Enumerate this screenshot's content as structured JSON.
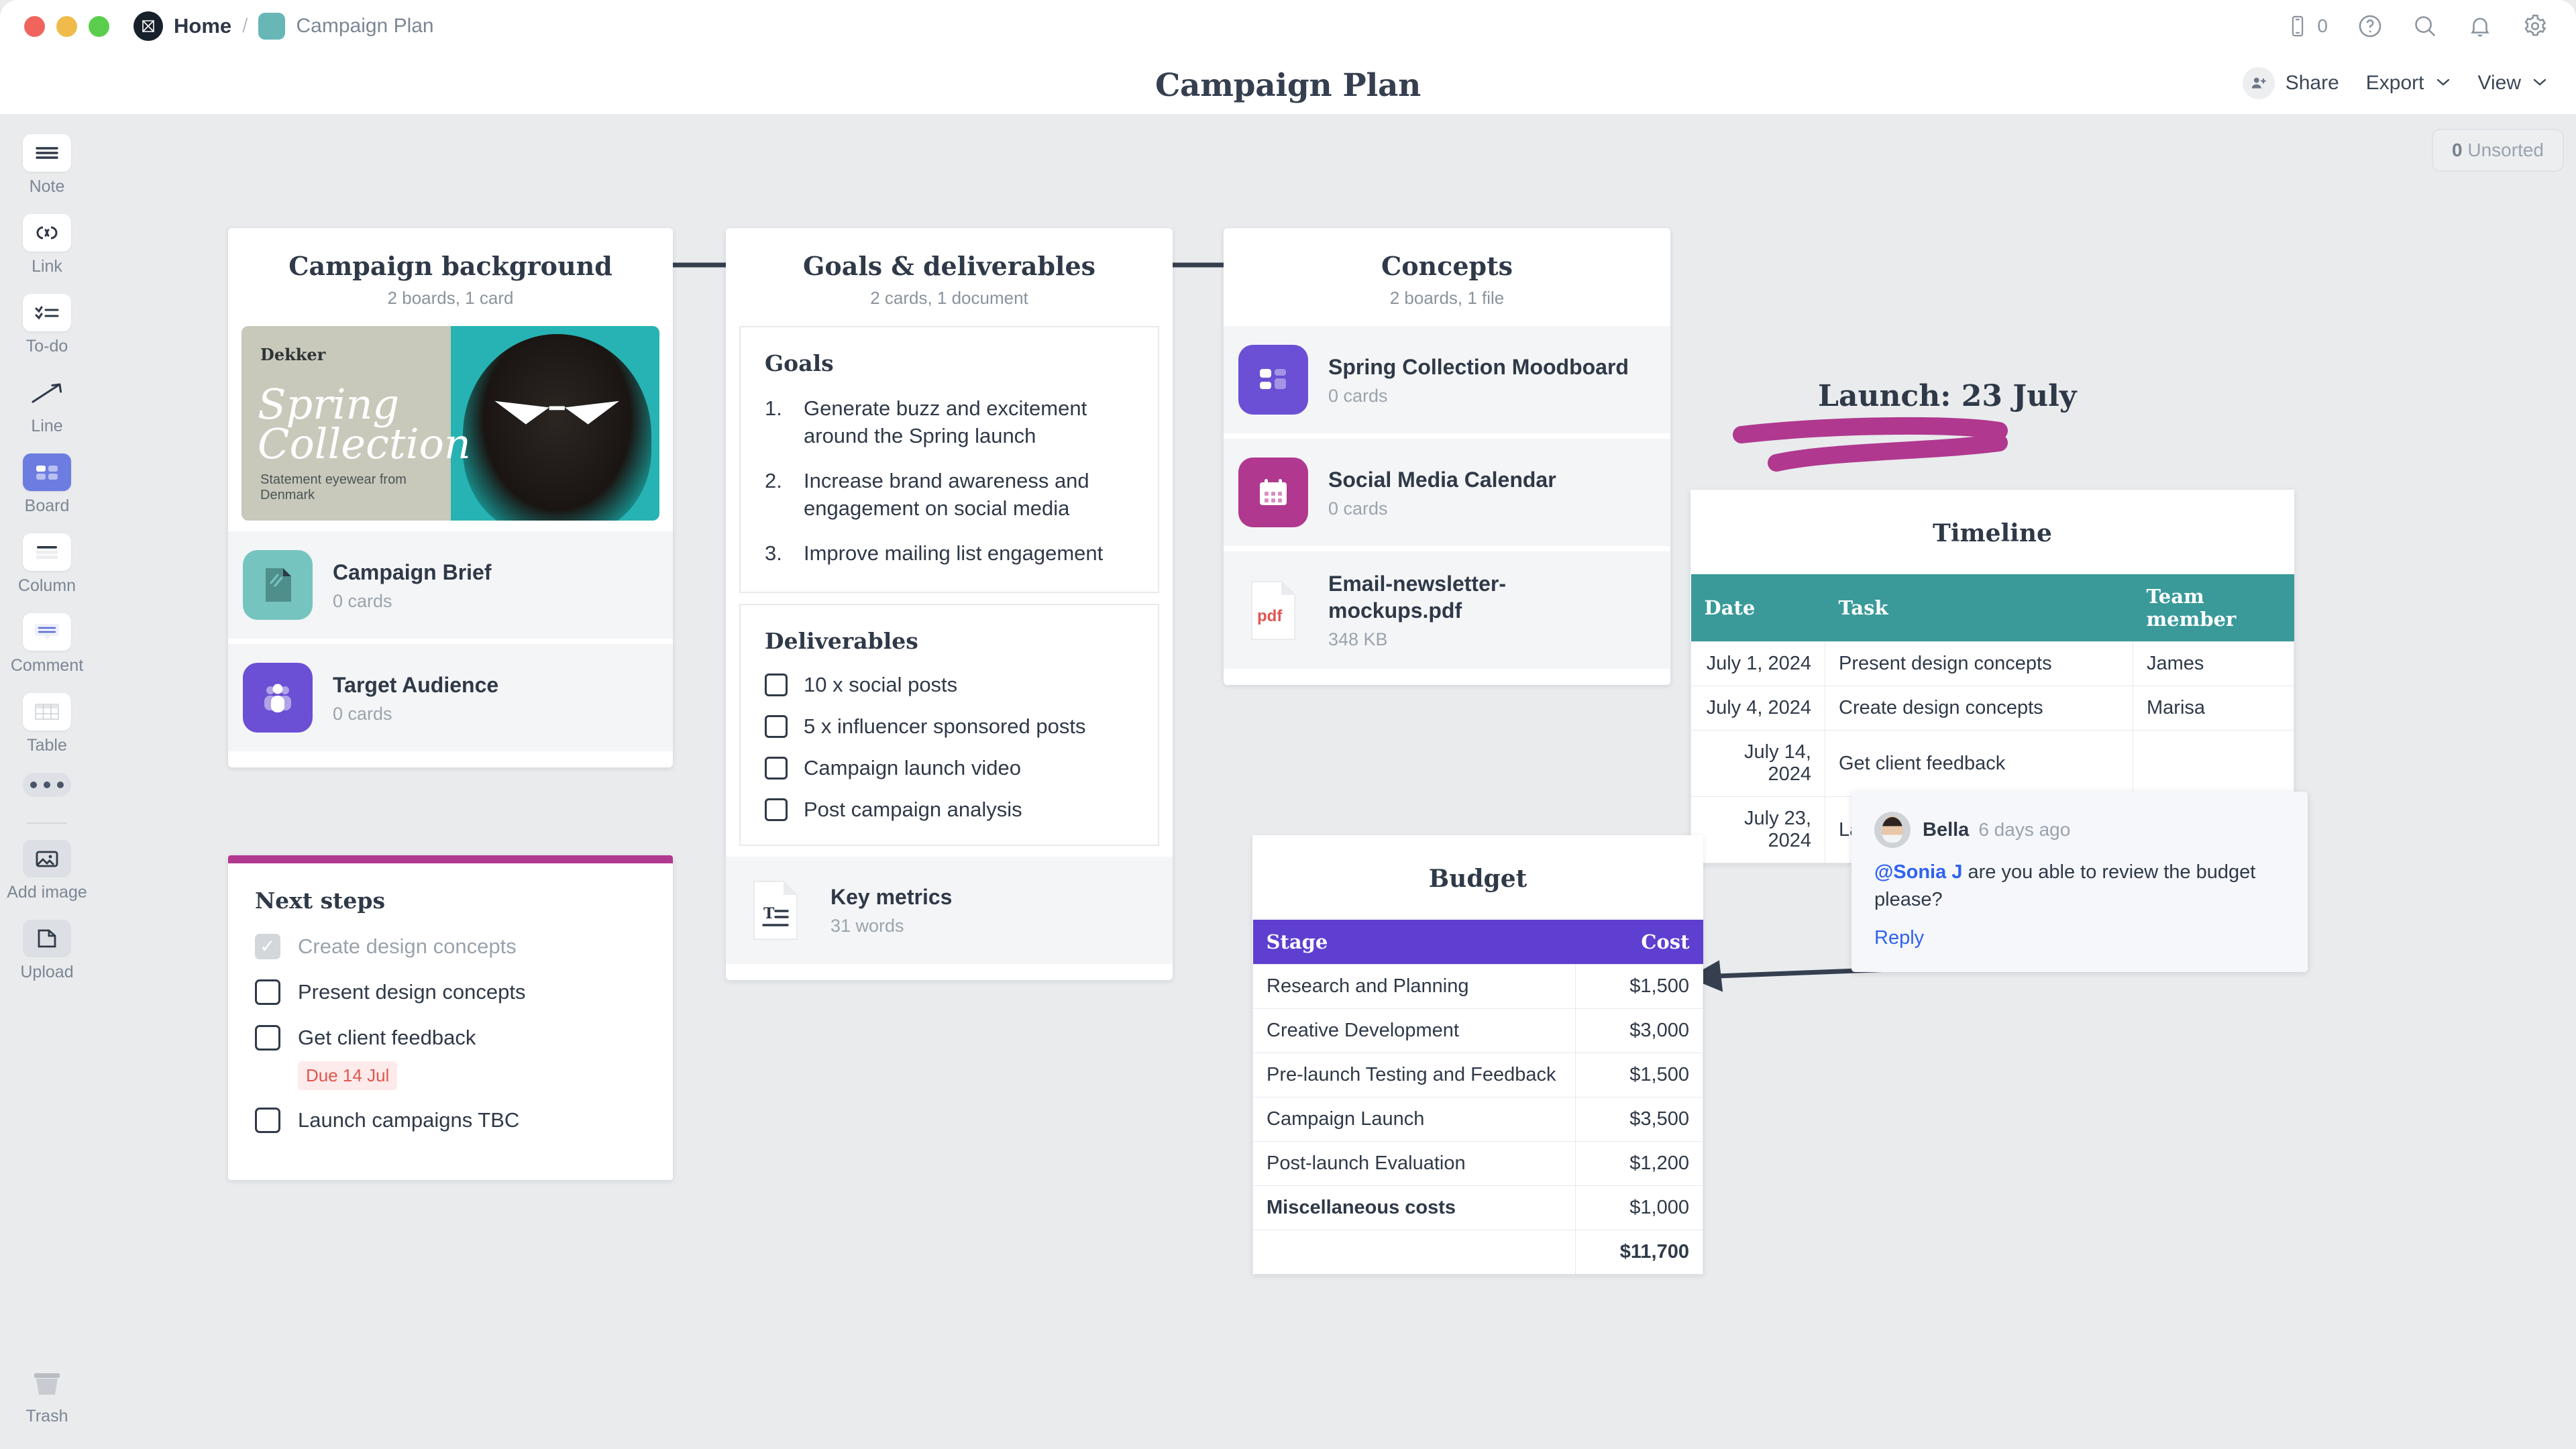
{
  "window": {
    "breadcrumb_home": "Home",
    "breadcrumb_separator": "/",
    "breadcrumb_current": "Campaign Plan",
    "logo_glyph": "M"
  },
  "topbar": {
    "device_count": "0",
    "icons": [
      "phone-icon",
      "help-icon",
      "search-icon",
      "bell-icon",
      "gear-icon"
    ]
  },
  "header": {
    "title": "Campaign Plan",
    "share_label": "Share",
    "export_label": "Export",
    "view_label": "View",
    "chevron": "⌄"
  },
  "canvas": {
    "unsorted_count": "0",
    "unsorted_label": "Unsorted"
  },
  "sidebar": {
    "items": [
      {
        "label": "Note",
        "icon": "note-icon"
      },
      {
        "label": "Link",
        "icon": "link-icon"
      },
      {
        "label": "To-do",
        "icon": "todo-icon"
      },
      {
        "label": "Line",
        "icon": "line-icon"
      },
      {
        "label": "Board",
        "icon": "board-icon"
      },
      {
        "label": "Column",
        "icon": "column-icon"
      },
      {
        "label": "Comment",
        "icon": "comment-icon"
      },
      {
        "label": "Table",
        "icon": "table-icon"
      }
    ],
    "more_label": "more-icon",
    "add_image_label": "Add image",
    "upload_label": "Upload",
    "trash_label": "Trash"
  },
  "boards": {
    "campaign_background": {
      "title": "Campaign background",
      "subtitle": "2 boards, 1 card",
      "poster": {
        "brand": "Dekker",
        "headline": "Spring\nCollection",
        "tagline": "Statement eyewear from Denmark"
      },
      "items": [
        {
          "name": "Campaign Brief",
          "meta": "0 cards",
          "icon": "document-icon",
          "color": "#76c4c0"
        },
        {
          "name": "Target Audience",
          "meta": "0 cards",
          "icon": "people-icon",
          "color": "#6b4fd4"
        }
      ]
    },
    "goals_deliverables": {
      "title": "Goals & deliverables",
      "subtitle": "2 cards, 1 document",
      "goals_heading": "Goals",
      "goals": [
        "Generate buzz and excitement around the Spring launch",
        "Increase brand awareness and engagement on social media",
        "Improve mailing list engagement"
      ],
      "deliverables_heading": "Deliverables",
      "deliverables": [
        {
          "label": "10 x social posts",
          "checked": false
        },
        {
          "label": "5 x influencer sponsored posts",
          "checked": false
        },
        {
          "label": "Campaign launch video",
          "checked": false
        },
        {
          "label": "Post campaign analysis",
          "checked": false
        }
      ],
      "document": {
        "name": "Key metrics",
        "meta": "31 words",
        "icon": "text-document-icon"
      }
    },
    "concepts": {
      "title": "Concepts",
      "subtitle": "2 boards, 1 file",
      "items": [
        {
          "name": "Spring Collection Moodboard",
          "meta": "0 cards",
          "icon": "board-icon",
          "color": "#6b4fd4"
        },
        {
          "name": "Social Media Calendar",
          "meta": "0 cards",
          "icon": "calendar-icon",
          "color": "#b0388f"
        },
        {
          "name": "Email-newsletter-mockups.pdf",
          "meta": "348 KB",
          "icon": "pdf-icon",
          "color": "#ffffff"
        }
      ],
      "pdf_glyph": "pdf"
    }
  },
  "next_steps": {
    "title": "Next steps",
    "accent_color": "#b0388f",
    "items": [
      {
        "label": "Create design concepts",
        "checked": true,
        "due": null
      },
      {
        "label": "Present design concepts",
        "checked": false,
        "due": null
      },
      {
        "label": "Get client feedback",
        "checked": false,
        "due": "Due 14 Jul"
      },
      {
        "label": "Launch campaigns TBC",
        "checked": false,
        "due": null
      }
    ]
  },
  "launch_note": {
    "text": "Launch: 23 July",
    "underline_color": "#b0388f"
  },
  "timeline": {
    "title": "Timeline",
    "header_color": "#3a9a9a",
    "columns": [
      "Date",
      "Task",
      "Team member"
    ],
    "rows": [
      [
        "July 1, 2024",
        "Present design concepts",
        "James"
      ],
      [
        "July 4, 2024",
        "Create design concepts",
        "Marisa"
      ],
      [
        "July 14, 2024",
        "Get client feedback",
        ""
      ],
      [
        "July 23, 2024",
        "Launch campaigns TBC",
        ""
      ]
    ]
  },
  "budget": {
    "title": "Budget",
    "header_color": "#5e3fd0",
    "columns": [
      "Stage",
      "Cost"
    ],
    "rows": [
      [
        "Research and Planning",
        "$1,500"
      ],
      [
        "Creative Development",
        "$3,000"
      ],
      [
        "Pre-launch Testing and Feedback",
        "$1,500"
      ],
      [
        "Campaign Launch",
        "$3,500"
      ],
      [
        "Post-launch Evaluation",
        "$1,200"
      ],
      [
        "Miscellaneous costs",
        "$1,000"
      ]
    ],
    "total_label": "",
    "total_value": "$11,700"
  },
  "comment": {
    "author": "Bella",
    "time": "6 days ago",
    "mention": "@Sonia J",
    "body": " are you able to review the budget please?",
    "reply_label": "Reply"
  }
}
